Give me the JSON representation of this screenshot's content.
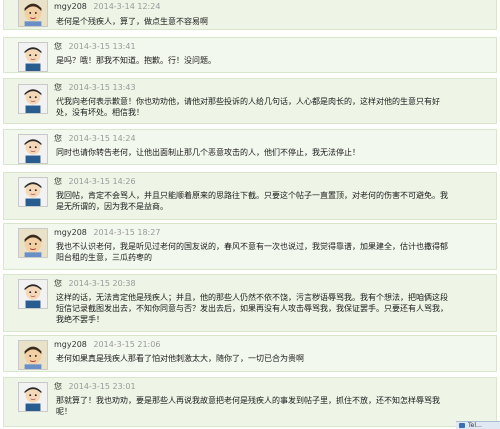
{
  "comments": [
    {
      "author": "mgy208",
      "date": "2014-3-14 12:24",
      "avatar": "cartoon-avatar",
      "text": "老何是个残疾人，算了，做点生意不容易啊"
    },
    {
      "author": "您",
      "date": "2014-3-15 13:41",
      "avatar": "default-avatar",
      "text": "是吗？哦！那我不知道。抱歉。行！没问题。"
    },
    {
      "author": "您",
      "date": "2014-3-15 13:43",
      "avatar": "default-avatar",
      "text": "代我向老何表示歉意！你也劝劝他，请他对那些投诉的人给几句话，人心都是肉长的，这样对他的生意只有好处，没有坏处。相信我！"
    },
    {
      "author": "您",
      "date": "2014-3-15 14:24",
      "avatar": "default-avatar",
      "text": "同时也请你转告老何，让他出面制止那几个恶意攻击的人，他们不停止，我无法停止！"
    },
    {
      "author": "您",
      "date": "2014-3-15 14:26",
      "avatar": "default-avatar",
      "text": "我回帖，肯定不会骂人，并且只能顺着原来的思路往下截。只要这个帖子一直置顶，对老何的伤害不可避免。我是无所谓的，因为我不是益商。"
    },
    {
      "author": "mgy208",
      "date": "2014-3-15 18:27",
      "avatar": "cartoon-avatar",
      "text": "我也不认识老何，我是听见过老何的国友说的，春风不意有一次也说过，我觉得靠谱，加果建全，估计也撒得郁阳台租的生意，三瓜药枣的"
    },
    {
      "author": "您",
      "date": "2014-3-15 20:38",
      "avatar": "default-avatar",
      "text": "这样的话，无法肯定他是残疾人；并且，他的那些人仍然不依不饶，污言秽语辱骂我。我有个想法，把咱俩这段短信记录截图发出去，不知你同意与否？发出去后，如果再没有人攻击辱骂我，我保证罢手。只要还有人骂我，我绝不罢手！"
    },
    {
      "author": "mgy208",
      "date": "2014-3-15 21:06",
      "avatar": "cartoon-avatar",
      "text": "老何如果真是残疾人那看了怕对他刺激太大，随你了，一切已合为贵啊"
    },
    {
      "author": "您",
      "date": "2014-3-15 23:01",
      "avatar": "default-avatar",
      "text": "那就算了！我也劝劝，要是那些人再说我故意把老何是残疾人的事发到帖子里，抓住不放，还不知怎样辱骂我呢！"
    }
  ],
  "taskbar": {
    "label": "Tel…"
  }
}
